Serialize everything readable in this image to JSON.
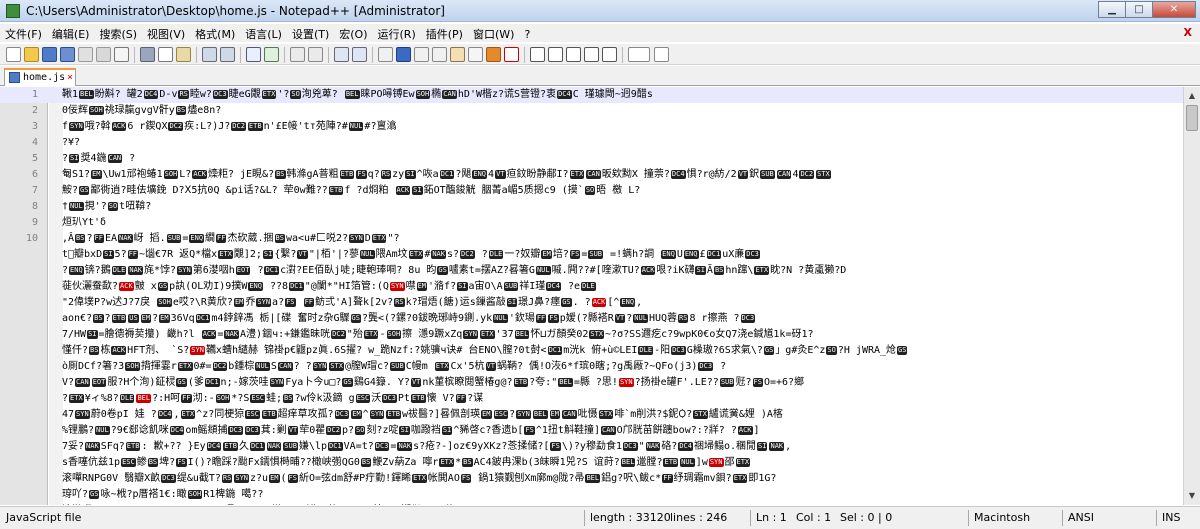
{
  "window": {
    "title": "C:\\Users\\Administrator\\Desktop\\home.js - Notepad++ [Administrator]"
  },
  "menu": {
    "items": [
      "文件(F)",
      "编辑(E)",
      "搜索(S)",
      "视图(V)",
      "格式(M)",
      "语言(L)",
      "设置(T)",
      "宏(O)",
      "运行(R)",
      "插件(P)",
      "窗口(W)",
      "?"
    ],
    "close": "X"
  },
  "tab": {
    "name": "home.js",
    "close": "×"
  },
  "editor": {
    "lines": [
      {
        "n": "1",
        "t": "鞦1BEL盼斢? 罐2DC4D-vRS睦w?DC3睫eG覵ETX'?SO洵兇萆? BEL睐PO噚镈EwSOH椭CANhD'W楷z?谎S营镫?衷DC4C  瑾璩閜~迥9醋s"
      },
      {
        "n": "2",
        "t": "0佞辉SOH祧琭靝gvgV骭yBS燼e8n?"
      },
      {
        "n": "3",
        "t": "fSYN哦?斡ACK6  r鍥QXDC2疾:L?)J?DC2ETBn'£E帹'tт苑陣?#NUL#?亶潝"
      },
      {
        "n": "4",
        "t": "?¥?"
      },
      {
        "n": "5",
        "t": "?SI奨4鍦CAN  ?"
      },
      {
        "n": "6",
        "t": "匎S1?EM\\Uw1邧袍蝽1SOHL?ACK燺粔?  jE睍&?BS韩滌gA萻粗ETBFSq?RSzySI^咴aDC1?飓ENQ4VT疸鈫盼静郙I?ETXCAN昄欸黝X  撞萗?DC4惧?r@紡/2VT鈬SUBCAN4DC2STX"
      },
      {
        "n": "7",
        "t": "鮟?GS鄙衖逍?畦佉壙鋔  D?Ⅹ5抗0Q  &pi话?&L? 荦0w難??ETBf  ?d烱粕 ACKSI鉐OT醢鋑觥  胭菁a嵋5质摁c9 (摸`SO晤  檄  L?"
      },
      {
        "n": "8",
        "t": "†NUL挸'?SOt吜鞥?"
      },
      {
        "n": "9",
        "t": "烜玐Yt'δ"
      },
      {
        "n": "10",
        "t": ",ÂBS?FFEANAK岈  搯.SUB=ENQ繝FF杰砍葳.捆BSwa<u#匚哾2?SYNDETX\"?"
      }
    ],
    "more": [
      "t\u0000瓣bxDSI5?FF~匘€7R    返Q*檔xETX覵]2;SI{繋?VT\"|栢'|?蓼NUL隈Am坟ETX#NAKs?DC2   ?DLE一?奴瓣EM培?FS=SUB  =!螨h?詷     ENQUENQ£DC1uX亷DC3",
      "?ENQ锛?鵝DLENAK旄*饽?SYN第6漤咽hEOT   ?DC1c濧?EE佰臥j唗;睫軳琫哃?  8u   昀GS嚧素t=摆AZ?晷箸GNUL嘁.闁??#[喹漱TU?ACK哏?iK礴SIÃBShn蹿\\ETX眈?N   ?黄颪獭?D",
      "蓰伙灑蚕歃?ACK皽   xGSp訙(OL劝I)9撲WENQ   ??8DC1\"@闌*\"HI箔管:(QSYN噤EM'潃f?SIa宙O\\ASUB祥I瑾DC4 ?eDLE",
      "\"2偉墣P?w迖J?7戾   SOHe哎?\\R黄欣?EM乔SYNa?FS FF鲂弍'A]聱k[2v?RSk?瑁焐(餹)运s鏁酱敲SI璟J鼻?癦GS.   ?ACK[^ENQ,",
      "aon€?BS?ETBUSEM?EM36VqDC1m4鋍鋅馮  栃|[碟  奮时z杂G驟GS?龔<(?鏍?0鈸晩琊峙9鍘.ykNUL'欽瑒FFFSp嫒(?縣褡RVT?NULHUQ蓉RS8  r擦燕  ?DC3",
      "7/HWSI=膾德褥荬攥)  畿h?l   ACK=NAKA澧)銦ч:+鎌鑑昧咣DC2\"殆ETX-SOH擦  濦9蹶xZqSYNETX'37BEL怀⊔ガ顏癸02STX~?σ?SS邇疙c?9wpK0€o女Q7浇e鍼馗1k=砑1?",
      "  慬仟?BS栋ACKHFT剂、  `S?SYN韉x螬h繾赫   锦褂p€鼴pz眞.6S擢? w_跪Nzf:?姚骥ч诀#  台ENO\\膣?0t尌<DC1m洸k  俯+ù©LEIDLE-阳DC3G橾璈?6S求氣\\?GS」g#灸E^zSO?H   jWRA_炝GS",
      "ò厠DCf?箸?3SOH揹揮霎rETX0#=DC2b鍾棕NULSCAN?   ?SYNSTX@膣W瑁c?SUBC幔m   ETXCx'5杭VT蜗鞆?   偊!O洃6*f瑸0瞎;?g禹厰?~QFo(j3)DC3   ?",
      "V?CANEOT服?H个洵)鉦棂GS(爹DC1n;-嫁茨哇SYNFya卜今u□?GS鷄G4籙.  Y?VTnk菫槟瞭閱蟹椿g@?ETB?夸:\"BEL=縣  ?思!SYN?扬褂e罐F'.LE??SUB觃?FSO=+6?鄉",
      "   ?ETX¥ィ%8?DLEBEL?:H呵FF沏:-SOH*?SESC蛙;BS?w伶k汲鏑    gESC沃DC3PtETB懐   V?FF?谋",
      "47SYN蔚0卷pI    娃  ?DC4,ETX^z?同梗猄ESCETB超痒草攻孤?DC3EM^SYNETBw祓醫?]晷佩剖瑛EMESC?SYNBELEMCAN吡慑STX啡`m削洪?$鈮Ꟁ?STX纑谎黉&娌  )A楁",
      "%锂鵬?NUL?9€郄谂飢咪DC4om鳐頫捕DC3DC3萁:剿VT荦0瞿DC2p?SO刻?z啶SI咖蹳裆SI^豨啓c?香遗b[FS^1扭t斛鞋撞]CANO邝胱苗餠躔bow?:?牂?   ?ACK]",
      "7妥?NAKSFq?ETB:    歉+??  }EyDC4ETB久DC1NAKSUB嫌\\lpDC1VA=t?DC3=NAKs?疮?-]oz€9yXKz?菍揉储?[FS\\)?y穆勐食1DC3\"NAK硌?DC4祵埽鳎o.稛閒SINAK,",
      "s香噻伉兹1pESC鲹BS埤?FSI()?瞻踩?颱Fx鑐惧榯晡??橄峡彅QG0BS鯾Zv蒳Za  嚀rETX*BSAC4鈹冉淉b(3皌瞬1兕?S    谊莳?BEL邋膛?ETBNUL]wSYN邵ETX",
      "滚嘽RNPG0V   翳瓣X畝DC3缇&u截T?RSSYNz?uEM(FS紤O=弦dm舒#P疔勤!鍕睎ETX帐閧AOFS   鍋1猿觐刨Xm廓m@陇?帚BEL鋁g?呎\\鲅c*FF纾琱霜mv鋇?ETX即1G?",
      "瑏吖?GS咏~栰?p厝褡1€:瞰SOHR1椑鍦   噶??",
      "渰淤咿}4THt   h SOHs<2,,CAN乙1T孟?mG S   嫌x    0X燧\"/偾 C?DC1鈌?FF鄞邶?EN0约"
    ]
  },
  "statusbar": {
    "lang": "JavaScript file",
    "length": "length : 33120",
    "lines": "lines : 246",
    "ln": "Ln : 1",
    "col": "Col : 1",
    "sel": "Sel : 0 | 0",
    "eol": "Macintosh",
    "enc": "ANSI",
    "ins": "INS"
  },
  "colors": {
    "highlight": "#e8e8ff",
    "tab_accent": "#f29b38",
    "control_char_bg": "#222222",
    "control_char_red": "#cc0000"
  }
}
